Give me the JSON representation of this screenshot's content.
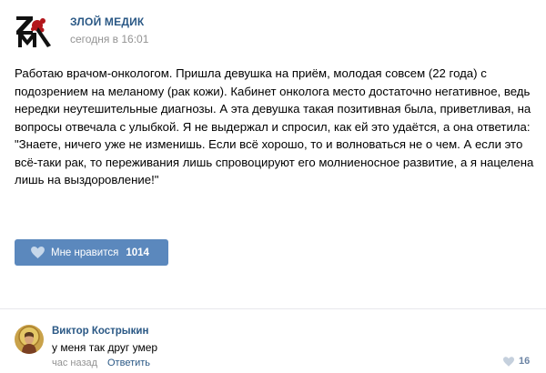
{
  "post": {
    "author": "ЗЛОЙ МЕДИК",
    "time": "сегодня в 16:01",
    "text": "Работаю врачом-онкологом. Пришла девушка на приём, молодая совсем (22 года) с подозрением на меланому (рак кожи). Кабинет онколога место достаточно негативное, ведь нередки неутешительные диагнозы. А эта девушка такая позитивная была, приветливая, на вопросы отвечала с улыбкой. Я не выдержал и спросил, как ей это удаётся, а она ответила: \"Знаете, ничего уже не изменишь. Если всё хорошо, то и волноваться не о чем. А если это всё-таки рак, то переживания лишь спровоцируют его молниеносное развитие, а я нацелена лишь на выздоровление!\"",
    "logo_icon": "zm-logo-icon",
    "like_button": {
      "label": "Мне нравится",
      "count": "1014",
      "icon": "heart-icon",
      "color": "#5b88bd"
    }
  },
  "comment": {
    "author": "Виктор Кострыкин",
    "text": "у меня так друг умер",
    "time": "час назад",
    "reply_label": "Ответить",
    "likes": "16",
    "avatar_icon": "avatar-icon",
    "like_icon": "heart-icon"
  },
  "colors": {
    "link": "#2a5885",
    "muted": "#939393",
    "divider": "#e7e8ec",
    "logo_red": "#b3161b"
  }
}
